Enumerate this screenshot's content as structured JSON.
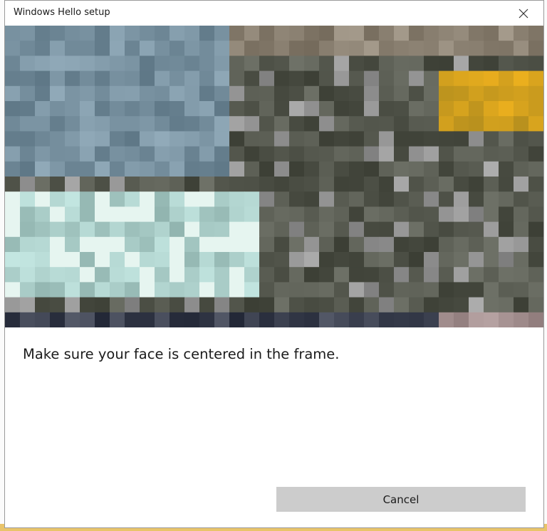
{
  "window": {
    "title": "Windows Hello setup",
    "close_icon": "close-icon"
  },
  "camera": {
    "description_icon": "camera-preview"
  },
  "instruction": "Make sure your face is centered in the frame.",
  "buttons": {
    "cancel": "Cancel"
  },
  "colors": {
    "cancel_background": "#cccccc",
    "dialog_border": "#9a9a9a"
  }
}
